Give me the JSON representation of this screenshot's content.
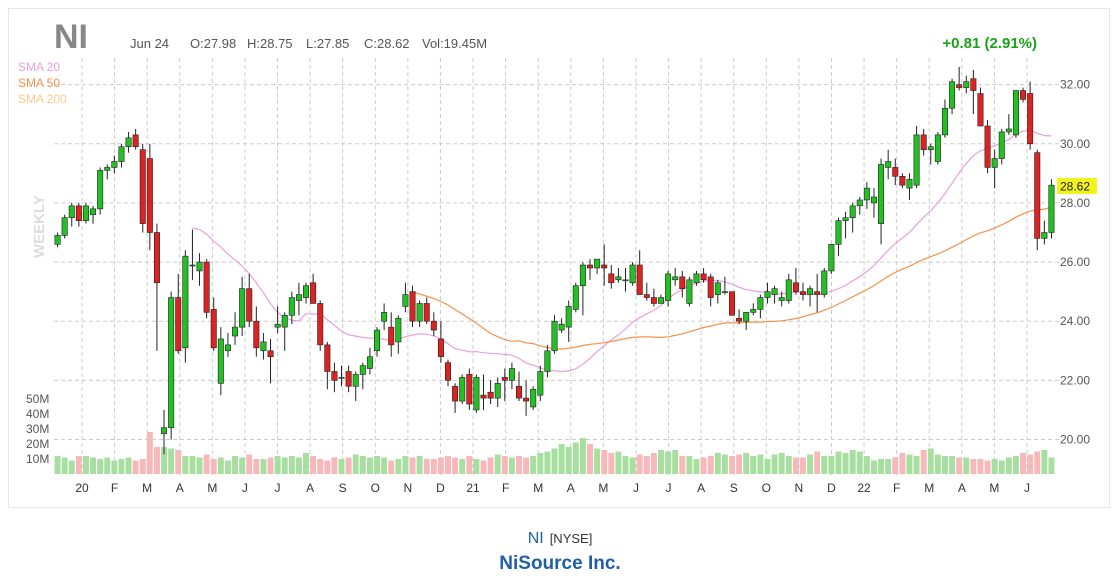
{
  "header": {
    "ticker": "NI",
    "date": "Jun 24",
    "open": "O:27.98",
    "high": "H:28.75",
    "low": "L:27.85",
    "close": "C:28.62",
    "volume": "Vol:19.45M",
    "change": "+0.81 (2.91%)",
    "change_color": "#1aa31a"
  },
  "legend": [
    {
      "label": "SMA 20",
      "color": "#e8a0e0"
    },
    {
      "label": "SMA 50",
      "color": "#f5914a"
    },
    {
      "label": "SMA 200",
      "color": "#f8c98a"
    }
  ],
  "period_label": "WEEKLY",
  "last_price_label": "28.62",
  "footer": {
    "ticker": "NI",
    "exchange": "[NYSE]",
    "company": "NiSource Inc."
  },
  "chart_data": {
    "type": "candlestick",
    "price_axis": {
      "ticks": [
        "32.00",
        "30.00",
        "28.00",
        "26.00",
        "24.00",
        "22.00",
        "20.00"
      ],
      "range": [
        18.8,
        32.9
      ]
    },
    "volume_axis": {
      "ticks": [
        "50M",
        "40M",
        "30M",
        "20M",
        "10M"
      ]
    },
    "x_labels": [
      "20",
      "F",
      "M",
      "A",
      "M",
      "J",
      "J",
      "A",
      "S",
      "O",
      "N",
      "D",
      "21",
      "F",
      "M",
      "A",
      "M",
      "J",
      "J",
      "A",
      "S",
      "O",
      "N",
      "D",
      "22",
      "F",
      "M",
      "A",
      "M",
      "J"
    ],
    "up_color": "#22c022",
    "down_color": "#dd2222",
    "candles": [
      [
        26.6,
        27.0,
        26.5,
        26.9
      ],
      [
        26.9,
        27.6,
        26.8,
        27.5
      ],
      [
        27.5,
        28.0,
        27.2,
        27.9
      ],
      [
        27.9,
        28.0,
        27.2,
        27.4
      ],
      [
        27.4,
        28.0,
        27.3,
        27.9
      ],
      [
        27.6,
        27.9,
        27.3,
        27.8
      ],
      [
        27.8,
        29.2,
        27.6,
        29.1
      ],
      [
        29.1,
        29.3,
        28.8,
        29.2
      ],
      [
        29.2,
        29.6,
        29.0,
        29.4
      ],
      [
        29.4,
        30.0,
        29.2,
        29.9
      ],
      [
        29.9,
        30.4,
        29.7,
        30.2
      ],
      [
        30.3,
        30.5,
        29.8,
        29.9
      ],
      [
        29.8,
        30.0,
        27.0,
        27.3
      ],
      [
        29.5,
        30.0,
        26.4,
        27.0
      ],
      [
        27.0,
        27.3,
        23.0,
        25.3
      ],
      [
        20.2,
        21.0,
        19.5,
        20.4
      ],
      [
        20.4,
        25.0,
        20.0,
        24.8
      ],
      [
        24.8,
        25.6,
        22.9,
        23.0
      ],
      [
        23.1,
        26.4,
        22.6,
        26.2
      ],
      [
        25.9,
        27.1,
        25.4,
        25.9
      ],
      [
        25.7,
        26.3,
        25.2,
        26.0
      ],
      [
        26.0,
        26.1,
        24.1,
        24.3
      ],
      [
        24.4,
        24.8,
        23.0,
        23.1
      ],
      [
        21.9,
        23.8,
        21.5,
        23.4
      ],
      [
        23.0,
        23.6,
        22.8,
        23.2
      ],
      [
        23.5,
        24.3,
        23.2,
        23.8
      ],
      [
        23.8,
        25.5,
        23.5,
        25.1
      ],
      [
        25.1,
        25.6,
        23.8,
        24.0
      ],
      [
        24.0,
        24.5,
        22.8,
        23.1
      ],
      [
        23.0,
        23.6,
        22.7,
        23.3
      ],
      [
        23.0,
        23.4,
        21.9,
        22.8
      ],
      [
        23.8,
        24.5,
        23.6,
        23.9
      ],
      [
        23.8,
        24.3,
        23.0,
        24.2
      ],
      [
        24.2,
        25.0,
        23.9,
        24.8
      ],
      [
        24.7,
        25.3,
        24.2,
        24.9
      ],
      [
        24.8,
        25.3,
        24.6,
        25.2
      ],
      [
        25.3,
        25.6,
        24.6,
        24.6
      ],
      [
        24.6,
        24.7,
        23.0,
        23.2
      ],
      [
        23.2,
        23.3,
        21.7,
        22.3
      ],
      [
        22.3,
        22.6,
        21.6,
        22.0
      ],
      [
        22.1,
        22.5,
        21.8,
        22.1
      ],
      [
        22.3,
        22.5,
        21.6,
        21.8
      ],
      [
        21.8,
        22.3,
        21.3,
        22.2
      ],
      [
        22.2,
        22.6,
        21.7,
        22.5
      ],
      [
        22.4,
        23.1,
        22.2,
        22.8
      ],
      [
        23.0,
        23.8,
        22.8,
        23.7
      ],
      [
        24.0,
        24.6,
        23.7,
        24.3
      ],
      [
        23.8,
        24.3,
        22.8,
        23.2
      ],
      [
        23.3,
        24.2,
        22.9,
        24.1
      ],
      [
        24.5,
        25.3,
        24.3,
        24.9
      ],
      [
        25.0,
        25.2,
        23.8,
        24.0
      ],
      [
        24.0,
        24.7,
        23.8,
        24.6
      ],
      [
        24.6,
        24.8,
        23.9,
        24.0
      ],
      [
        24.0,
        24.3,
        23.5,
        23.7
      ],
      [
        23.4,
        24.0,
        22.6,
        22.8
      ],
      [
        22.6,
        22.7,
        21.8,
        22.0
      ],
      [
        21.8,
        21.9,
        20.9,
        21.3
      ],
      [
        21.3,
        22.2,
        21.2,
        22.1
      ],
      [
        22.2,
        22.4,
        21.0,
        21.2
      ],
      [
        21.0,
        22.2,
        20.9,
        22.1
      ],
      [
        21.5,
        22.2,
        21.0,
        21.4
      ],
      [
        21.6,
        22.0,
        21.2,
        21.4
      ],
      [
        21.4,
        22.1,
        21.1,
        21.9
      ],
      [
        22.1,
        22.4,
        21.3,
        22.0
      ],
      [
        22.0,
        22.6,
        21.7,
        22.4
      ],
      [
        21.8,
        22.3,
        21.3,
        21.4
      ],
      [
        21.4,
        22.0,
        20.8,
        21.3
      ],
      [
        21.1,
        21.8,
        21.0,
        21.7
      ],
      [
        21.5,
        22.5,
        21.3,
        22.3
      ],
      [
        22.3,
        23.2,
        22.1,
        23.0
      ],
      [
        23.0,
        24.2,
        22.9,
        24.0
      ],
      [
        23.7,
        24.1,
        23.6,
        23.9
      ],
      [
        23.8,
        24.7,
        23.3,
        24.5
      ],
      [
        24.4,
        25.3,
        24.3,
        25.2
      ],
      [
        25.2,
        26.0,
        24.2,
        25.9
      ],
      [
        25.9,
        26.1,
        25.4,
        25.8
      ],
      [
        25.8,
        26.1,
        25.6,
        26.1
      ],
      [
        25.9,
        26.6,
        25.2,
        25.8
      ],
      [
        25.6,
        25.9,
        25.1,
        25.3
      ],
      [
        25.4,
        25.8,
        25.3,
        25.5
      ],
      [
        25.4,
        25.8,
        25.0,
        25.4
      ],
      [
        25.3,
        26.0,
        25.2,
        25.9
      ],
      [
        25.9,
        26.4,
        25.2,
        24.9
      ],
      [
        24.9,
        25.3,
        24.7,
        24.8
      ],
      [
        24.8,
        25.1,
        24.5,
        24.6
      ],
      [
        24.6,
        24.9,
        24.6,
        24.8
      ],
      [
        24.7,
        25.7,
        24.5,
        25.6
      ],
      [
        25.4,
        25.8,
        25.2,
        25.5
      ],
      [
        25.5,
        25.7,
        24.8,
        25.1
      ],
      [
        24.6,
        25.5,
        24.5,
        25.4
      ],
      [
        25.3,
        25.7,
        25.2,
        25.6
      ],
      [
        25.6,
        25.8,
        25.3,
        25.4
      ],
      [
        25.5,
        25.6,
        24.5,
        24.8
      ],
      [
        24.9,
        25.4,
        24.6,
        25.3
      ],
      [
        25.0,
        25.5,
        24.9,
        25.0
      ],
      [
        25.0,
        25.0,
        24.2,
        24.2
      ],
      [
        24.1,
        24.4,
        23.9,
        24.0
      ],
      [
        24.0,
        24.3,
        23.7,
        24.3
      ],
      [
        24.3,
        24.6,
        24.2,
        24.4
      ],
      [
        24.4,
        24.9,
        24.1,
        24.8
      ],
      [
        24.8,
        25.3,
        24.6,
        25.0
      ],
      [
        24.9,
        25.2,
        24.6,
        25.1
      ],
      [
        24.7,
        25.0,
        24.5,
        24.8
      ],
      [
        24.7,
        25.6,
        24.6,
        25.4
      ],
      [
        25.3,
        25.8,
        24.9,
        25.0
      ],
      [
        25.0,
        25.3,
        24.7,
        24.9
      ],
      [
        24.9,
        25.2,
        24.5,
        25.1
      ],
      [
        25.0,
        25.6,
        24.3,
        24.9
      ],
      [
        24.9,
        25.8,
        24.8,
        25.7
      ],
      [
        25.7,
        26.6,
        25.6,
        26.6
      ],
      [
        26.6,
        27.5,
        26.2,
        27.4
      ],
      [
        27.4,
        27.7,
        26.8,
        27.5
      ],
      [
        27.5,
        28.0,
        27.0,
        27.9
      ],
      [
        27.9,
        28.2,
        27.6,
        28.1
      ],
      [
        28.1,
        28.7,
        27.8,
        28.5
      ],
      [
        28.0,
        28.5,
        27.5,
        28.2
      ],
      [
        27.3,
        29.5,
        26.6,
        29.3
      ],
      [
        29.2,
        29.8,
        28.8,
        29.4
      ],
      [
        29.2,
        29.5,
        28.6,
        28.9
      ],
      [
        28.9,
        29.0,
        28.5,
        28.6
      ],
      [
        28.5,
        29.0,
        28.1,
        28.8
      ],
      [
        28.6,
        30.6,
        28.5,
        30.3
      ],
      [
        30.3,
        30.5,
        29.6,
        29.8
      ],
      [
        29.8,
        30.0,
        29.3,
        29.9
      ],
      [
        29.4,
        30.4,
        29.3,
        30.3
      ],
      [
        30.3,
        31.5,
        30.2,
        31.2
      ],
      [
        31.2,
        32.2,
        31.0,
        32.1
      ],
      [
        32.0,
        32.6,
        31.8,
        31.9
      ],
      [
        31.9,
        32.3,
        31.7,
        32.1
      ],
      [
        32.2,
        32.5,
        31.0,
        31.8
      ],
      [
        31.7,
        31.9,
        30.8,
        30.6
      ],
      [
        30.6,
        30.8,
        29.0,
        29.2
      ],
      [
        29.2,
        29.8,
        28.5,
        29.5
      ],
      [
        29.5,
        30.5,
        29.3,
        30.4
      ],
      [
        30.4,
        31.0,
        30.3,
        30.5
      ],
      [
        30.3,
        31.0,
        30.2,
        31.8
      ],
      [
        31.8,
        31.9,
        31.4,
        31.5
      ],
      [
        31.7,
        32.1,
        29.8,
        30.0
      ],
      [
        29.7,
        29.8,
        26.4,
        26.8
      ],
      [
        26.8,
        27.4,
        26.6,
        27.0
      ],
      [
        27.0,
        28.8,
        26.8,
        28.6
      ]
    ],
    "volume_millions": [
      12,
      11,
      9,
      12,
      12,
      11,
      10,
      11,
      9,
      10,
      11,
      9,
      10,
      28,
      18,
      18,
      17,
      16,
      12,
      12,
      11,
      13,
      10,
      11,
      9,
      12,
      11,
      13,
      10,
      10,
      11,
      12,
      11,
      12,
      11,
      14,
      12,
      10,
      9,
      11,
      10,
      11,
      13,
      12,
      11,
      12,
      11,
      9,
      10,
      12,
      11,
      12,
      10,
      10,
      11,
      12,
      11,
      10,
      12,
      10,
      9,
      11,
      13,
      12,
      11,
      12,
      11,
      12,
      14,
      15,
      17,
      20,
      18,
      21,
      24,
      20,
      17,
      16,
      14,
      15,
      12,
      11,
      13,
      12,
      14,
      16,
      15,
      16,
      12,
      12,
      10,
      11,
      12,
      14,
      13,
      12,
      13,
      14,
      12,
      13,
      10,
      13,
      14,
      12,
      11,
      11,
      13,
      15,
      12,
      12,
      15,
      14,
      16,
      15,
      12,
      9,
      10,
      10,
      11,
      14,
      13,
      12,
      16,
      17,
      13,
      12,
      12,
      11,
      11,
      10,
      10,
      9,
      10,
      9,
      11,
      12,
      14,
      13,
      15,
      16,
      11
    ]
  }
}
